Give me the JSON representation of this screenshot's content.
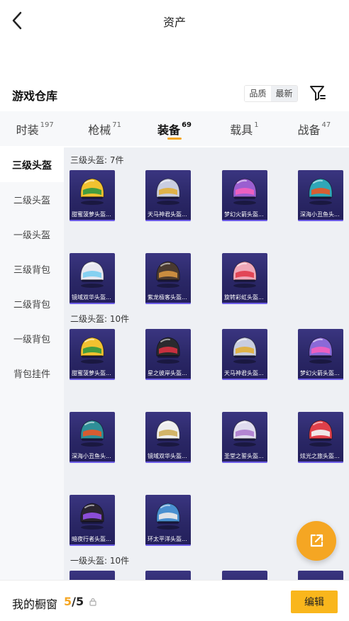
{
  "header": {
    "title": "资产"
  },
  "warehouse": {
    "title": "游戏仓库",
    "sort_options": [
      "品质",
      "最新"
    ],
    "active_sort": 1
  },
  "tabs": [
    {
      "label": "时装",
      "count": "197"
    },
    {
      "label": "枪械",
      "count": "71"
    },
    {
      "label": "装备",
      "count": "69",
      "active": true
    },
    {
      "label": "载具",
      "count": "1"
    },
    {
      "label": "战备",
      "count": "47"
    }
  ],
  "sidebar": {
    "items": [
      "三级头盔",
      "二级头盔",
      "一级头盔",
      "三级背包",
      "二级背包",
      "一级背包",
      "背包挂件"
    ],
    "active": 0
  },
  "sections": [
    {
      "title": "三级头盔: 7件",
      "items": [
        {
          "name": "甜蜜菠萝头盔...",
          "color": "#f2c230",
          "accent": "#3a9a40"
        },
        {
          "name": "天马神君头盔...",
          "color": "#c9cde0",
          "accent": "#e0b040"
        },
        {
          "name": "梦幻火箭头盔...",
          "color": "#9a5fd0",
          "accent": "#f060c0"
        },
        {
          "name": "深海小丑鱼头...",
          "color": "#2fa7b8",
          "accent": "#e05a2a"
        },
        {
          "name": "镜域双华头盔...",
          "color": "#e8e8f0",
          "accent": "#7fd0f0"
        },
        {
          "name": "紫龙极客头盔...",
          "color": "#4a3a30",
          "accent": "#d09040"
        },
        {
          "name": "旋转彩虹头盔...",
          "color": "#f0a8b8",
          "accent": "#e04050"
        }
      ]
    },
    {
      "title": "二级头盔: 10件",
      "items": [
        {
          "name": "甜蜜菠萝头盔...",
          "color": "#f2c230",
          "accent": "#3a9a40"
        },
        {
          "name": "星之彼岸头盔...",
          "color": "#2a2a2e",
          "accent": "#d03040"
        },
        {
          "name": "天马神君头盔...",
          "color": "#c9cde0",
          "accent": "#e0b040"
        },
        {
          "name": "梦幻火箭头盔...",
          "color": "#8a6ad8",
          "accent": "#f060c0"
        },
        {
          "name": "深海小丑鱼头...",
          "color": "#2f8f98",
          "accent": "#e05a2a"
        },
        {
          "name": "镜域双华头盔...",
          "color": "#eeeeee",
          "accent": "#d0b060"
        },
        {
          "name": "圣堂之誓头盔...",
          "color": "#e0dcef",
          "accent": "#b080d0"
        },
        {
          "name": "炫光之旅头盔...",
          "color": "#e0404a",
          "accent": "#f0f0f0"
        },
        {
          "name": "暗夜行者头盔...",
          "color": "#2a2430",
          "accent": "#9050e0"
        },
        {
          "name": "环太平洋头盔...",
          "color": "#4a90d0",
          "accent": "#e8e8e8"
        }
      ]
    },
    {
      "title": "一级头盔: 10件",
      "items": []
    }
  ],
  "footer": {
    "label": "我的橱窗",
    "current": "5",
    "total": "/5",
    "edit_label": "编辑"
  }
}
